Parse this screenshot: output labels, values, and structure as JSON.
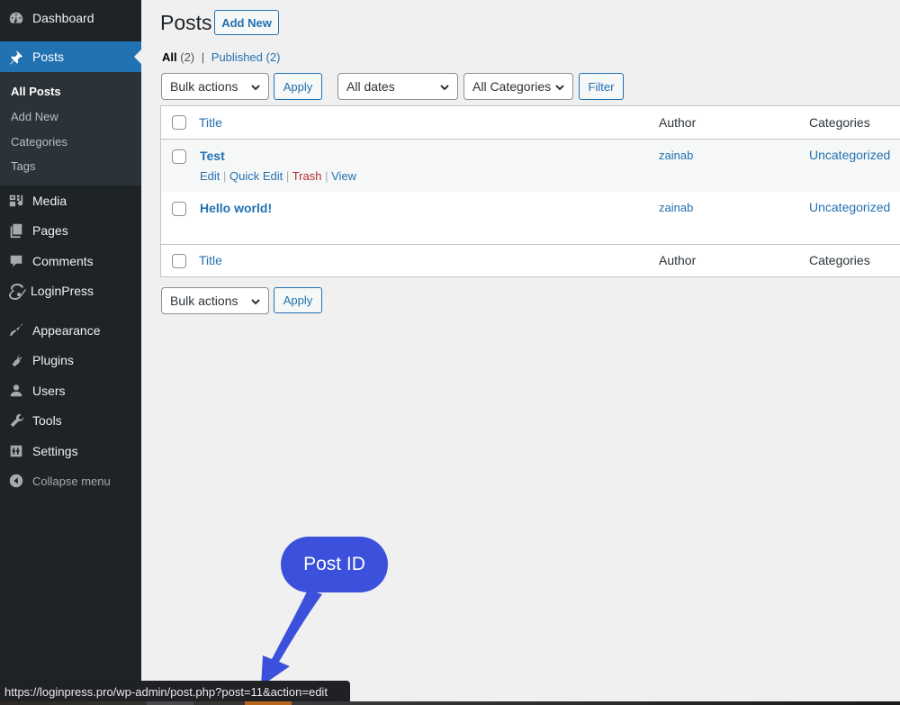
{
  "sidebar": {
    "items": [
      {
        "label": "Dashboard",
        "icon": "dashboard-icon"
      },
      {
        "label": "Posts",
        "icon": "pin-icon",
        "active": true
      },
      {
        "label": "Media",
        "icon": "media-icon"
      },
      {
        "label": "Pages",
        "icon": "pages-icon"
      },
      {
        "label": "Comments",
        "icon": "comments-icon"
      },
      {
        "label": "LoginPress",
        "icon": "loginpress-icon"
      },
      {
        "label": "Appearance",
        "icon": "brush-icon"
      },
      {
        "label": "Plugins",
        "icon": "plug-icon"
      },
      {
        "label": "Users",
        "icon": "user-icon"
      },
      {
        "label": "Tools",
        "icon": "wrench-icon"
      },
      {
        "label": "Settings",
        "icon": "settings-icon"
      },
      {
        "label": "Collapse menu",
        "icon": "collapse-icon"
      }
    ],
    "submenu": [
      {
        "label": "All Posts",
        "current": true
      },
      {
        "label": "Add New"
      },
      {
        "label": "Categories"
      },
      {
        "label": "Tags"
      }
    ],
    "active_color": "#2271b1"
  },
  "header": {
    "title": "Posts",
    "add_new_label": "Add New"
  },
  "views": {
    "all_label": "All",
    "all_count": "(2)",
    "separator": "|",
    "published_label": "Published",
    "published_count": "(2)"
  },
  "filters": {
    "bulk_actions": "Bulk actions",
    "apply_label": "Apply",
    "dates": "All dates",
    "categories": "All Categories",
    "filter_label": "Filter"
  },
  "table": {
    "columns": [
      "Title",
      "Author",
      "Categories"
    ],
    "rows": [
      {
        "title": "Test",
        "author": "zainab",
        "category": "Uncategorized",
        "actions": {
          "edit": "Edit",
          "quick_edit": "Quick Edit",
          "trash": "Trash",
          "view": "View",
          "sep": "|"
        }
      },
      {
        "title": "Hello world!",
        "author": "zainab",
        "category": "Uncategorized"
      }
    ]
  },
  "bottom_filters": {
    "bulk_actions": "Bulk actions",
    "apply_label": "Apply"
  },
  "annotation": {
    "label": "Post ID",
    "color": "#3b50db"
  },
  "statusbar": {
    "url": "https://loginpress.pro/wp-admin/post.php?post=11&action=edit"
  }
}
